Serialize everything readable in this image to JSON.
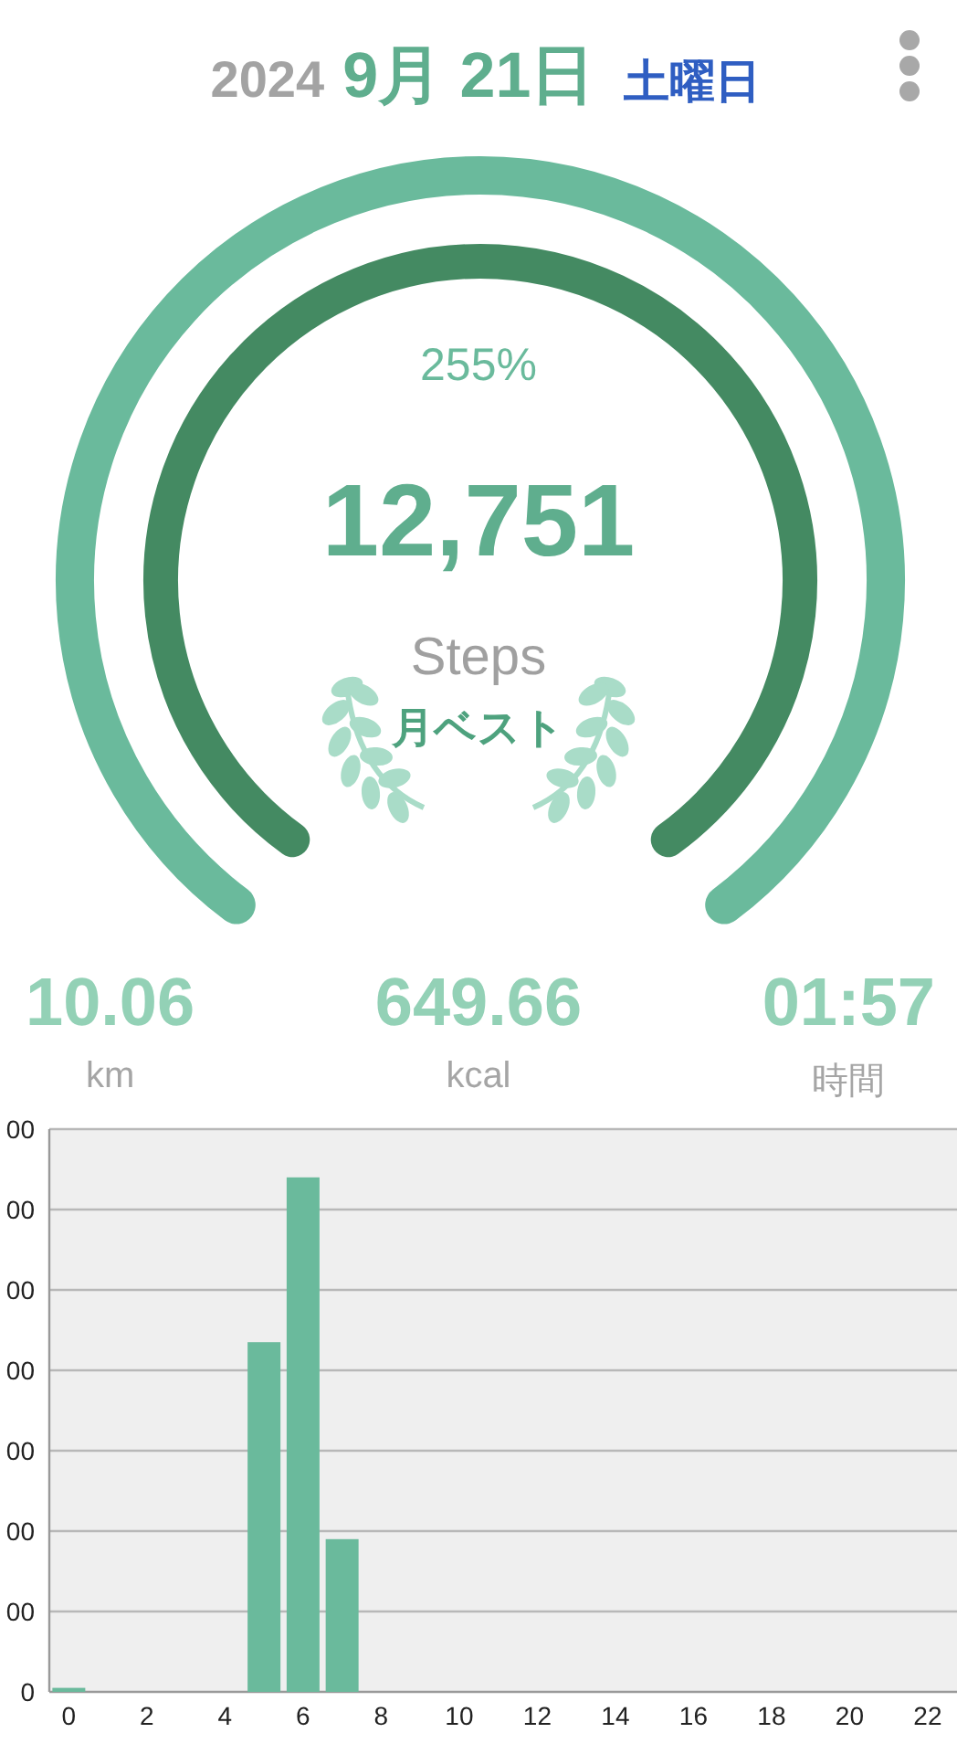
{
  "header": {
    "year": "2024",
    "date": "9月 21日",
    "weekday": "土曜日"
  },
  "ring": {
    "percent": "255%",
    "steps": "12,751",
    "unit": "Steps",
    "badge": "月ベスト"
  },
  "stats": [
    {
      "value": "10.06",
      "label": "km"
    },
    {
      "value": "649.66",
      "label": "kcal"
    },
    {
      "value": "01:57",
      "label": "時間"
    }
  ],
  "chart": {
    "y_axis_labels": [
      "00",
      "00",
      "00",
      "00",
      "00",
      "00",
      "00",
      "0"
    ],
    "x_axis_labels": [
      "0",
      "2",
      "4",
      "6",
      "8",
      "10",
      "12",
      "14",
      "16",
      "18",
      "20",
      "22"
    ]
  }
}
